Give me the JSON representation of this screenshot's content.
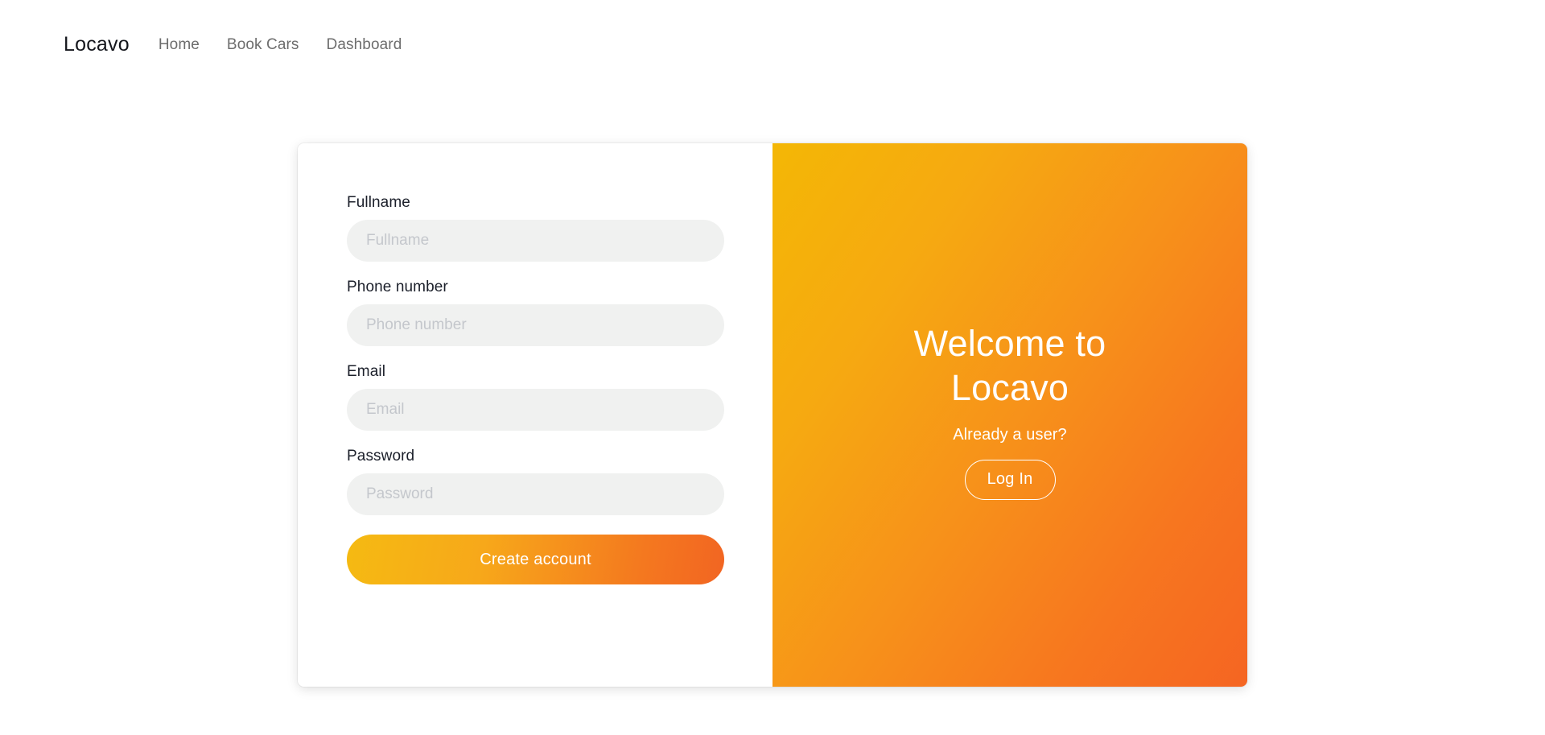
{
  "navbar": {
    "brand": "Locavo",
    "links": [
      {
        "label": "Home"
      },
      {
        "label": "Book Cars"
      },
      {
        "label": "Dashboard"
      }
    ]
  },
  "auth_card": {
    "form": {
      "fields": [
        {
          "label": "Fullname",
          "placeholder": "Fullname",
          "value": ""
        },
        {
          "label": "Phone number",
          "placeholder": "Phone number",
          "value": ""
        },
        {
          "label": "Email",
          "placeholder": "Email",
          "value": ""
        },
        {
          "label": "Password",
          "placeholder": "Password",
          "value": ""
        }
      ],
      "submit_label": "Create account"
    },
    "welcome": {
      "title": "Welcome to Locavo",
      "subtitle": "Already a user?",
      "login_label": "Log In"
    }
  },
  "colors": {
    "gradient_start": "#f4b705",
    "gradient_end": "#f56522",
    "button_gradient_start": "#f5ba12",
    "button_gradient_end": "#f26522",
    "label_text": "#1b1f2a",
    "nav_link_text": "#6d6d6d",
    "input_background": "#f0f1f0",
    "placeholder_text": "#c4c7cc",
    "card_background": "#ffffff"
  }
}
